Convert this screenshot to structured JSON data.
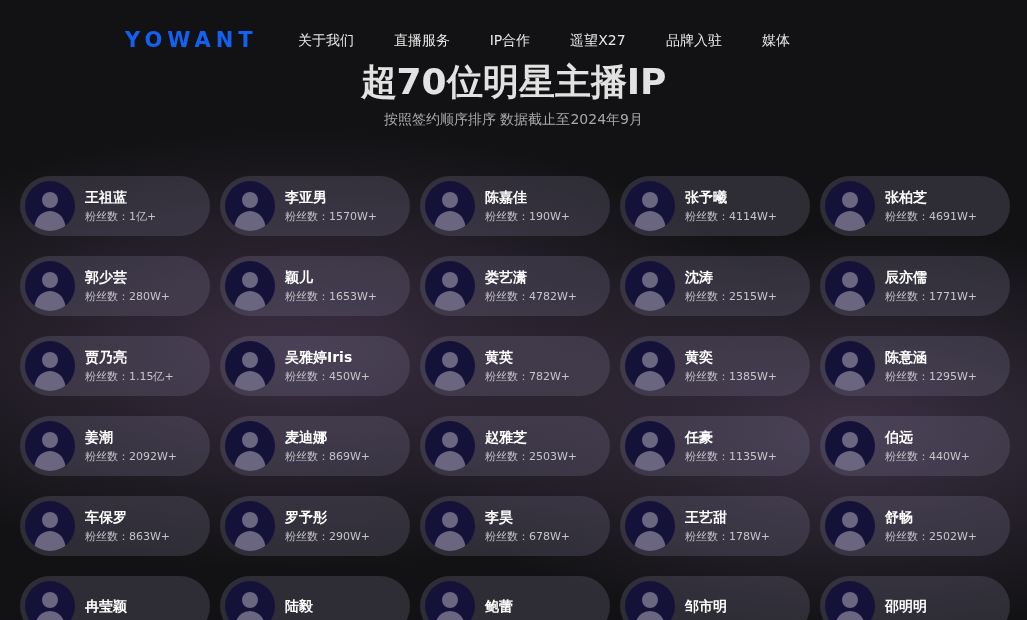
{
  "header": {
    "logo": "YOWANT",
    "nav": [
      "关于我们",
      "直播服务",
      "IP合作",
      "遥望X27",
      "品牌入驻",
      "媒体"
    ]
  },
  "hero": {
    "title": "超70位明星主播IP",
    "subtitle": "按照签约顺序排序 数据截止至2024年9月"
  },
  "stars": [
    {
      "name": "王祖蓝",
      "fans": "粉丝数：1亿+"
    },
    {
      "name": "李亚男",
      "fans": "粉丝数：1570W+"
    },
    {
      "name": "陈嘉佳",
      "fans": "粉丝数：190W+"
    },
    {
      "name": "张予曦",
      "fans": "粉丝数：4114W+"
    },
    {
      "name": "张柏芝",
      "fans": "粉丝数：4691W+"
    },
    {
      "name": "郭少芸",
      "fans": "粉丝数：280W+"
    },
    {
      "name": "颖儿",
      "fans": "粉丝数：1653W+"
    },
    {
      "name": "娄艺潇",
      "fans": "粉丝数：4782W+"
    },
    {
      "name": "沈涛",
      "fans": "粉丝数：2515W+"
    },
    {
      "name": "辰亦儒",
      "fans": "粉丝数：1771W+"
    },
    {
      "name": "贾乃亮",
      "fans": "粉丝数：1.15亿+"
    },
    {
      "name": "吴雅婷Iris",
      "fans": "粉丝数：450W+"
    },
    {
      "name": "黄英",
      "fans": "粉丝数：782W+"
    },
    {
      "name": "黄奕",
      "fans": "粉丝数：1385W+"
    },
    {
      "name": "陈意涵",
      "fans": "粉丝数：1295W+"
    },
    {
      "name": "姜潮",
      "fans": "粉丝数：2092W+"
    },
    {
      "name": "麦迪娜",
      "fans": "粉丝数：869W+"
    },
    {
      "name": "赵雅芝",
      "fans": "粉丝数：2503W+"
    },
    {
      "name": "任豪",
      "fans": "粉丝数：1135W+"
    },
    {
      "name": "伯远",
      "fans": "粉丝数：440W+"
    },
    {
      "name": "车保罗",
      "fans": "粉丝数：863W+"
    },
    {
      "name": "罗予彤",
      "fans": "粉丝数：290W+"
    },
    {
      "name": "李昊",
      "fans": "粉丝数：678W+"
    },
    {
      "name": "王艺甜",
      "fans": "粉丝数：178W+"
    },
    {
      "name": "舒畅",
      "fans": "粉丝数：2502W+"
    },
    {
      "name": "冉莹颖"
    },
    {
      "name": "陆毅"
    },
    {
      "name": "鲍蕾"
    },
    {
      "name": "邹市明"
    },
    {
      "name": "邵明明"
    }
  ]
}
